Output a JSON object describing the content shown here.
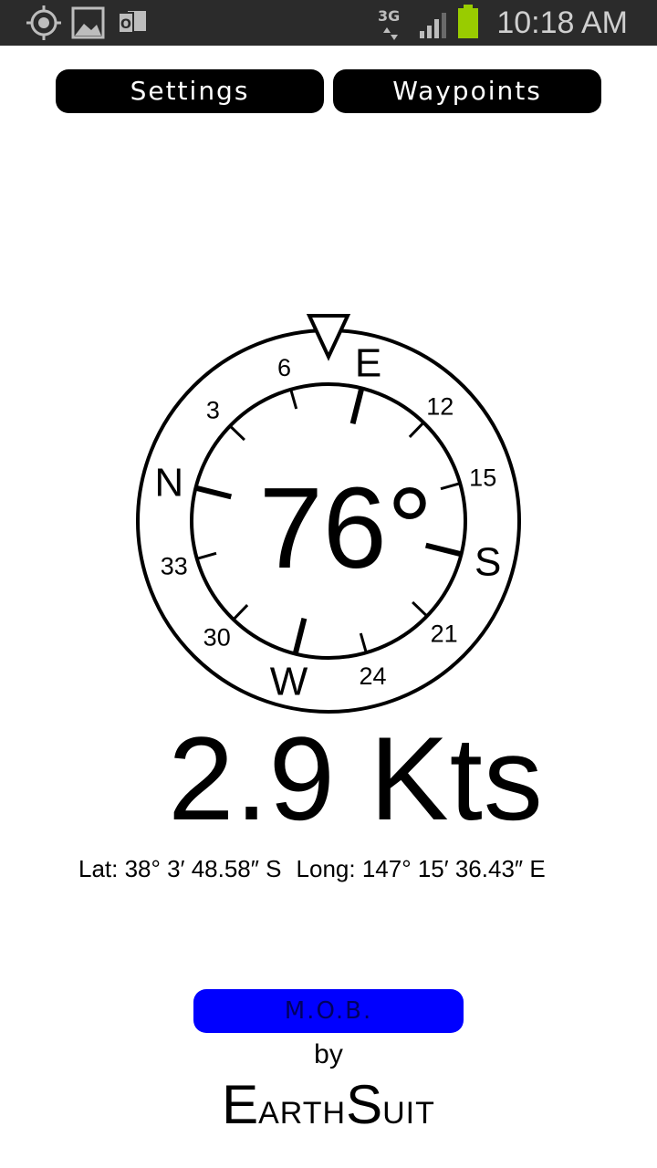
{
  "status_bar": {
    "time": "10:18 AM",
    "network": "3G",
    "icons": [
      "gps-icon",
      "gallery-icon",
      "outlook-icon",
      "signal-icon",
      "battery-icon"
    ]
  },
  "buttons": {
    "settings": "Settings",
    "waypoints": "Waypoints",
    "mob": "M.O.B."
  },
  "compass": {
    "heading": "76°",
    "heading_value": 76,
    "cardinals": [
      "N",
      "E",
      "S",
      "W"
    ],
    "numbers": [
      "3",
      "6",
      "12",
      "15",
      "21",
      "24",
      "30",
      "33"
    ]
  },
  "speed": "2.9 Kts",
  "position": {
    "lat": "Lat: 38° 3′ 48.58″ S",
    "long": "Long: 147° 15′ 36.43″ E"
  },
  "credit": {
    "by": "by",
    "brand_e": "E",
    "brand_arth": "ARTH",
    "brand_s": "S",
    "brand_uit": "UIT"
  },
  "colors": {
    "status_bar_bg": "#2b2b2b",
    "battery": "#99cc00",
    "mob_button": "#0000ff",
    "button_bg": "#000000"
  }
}
